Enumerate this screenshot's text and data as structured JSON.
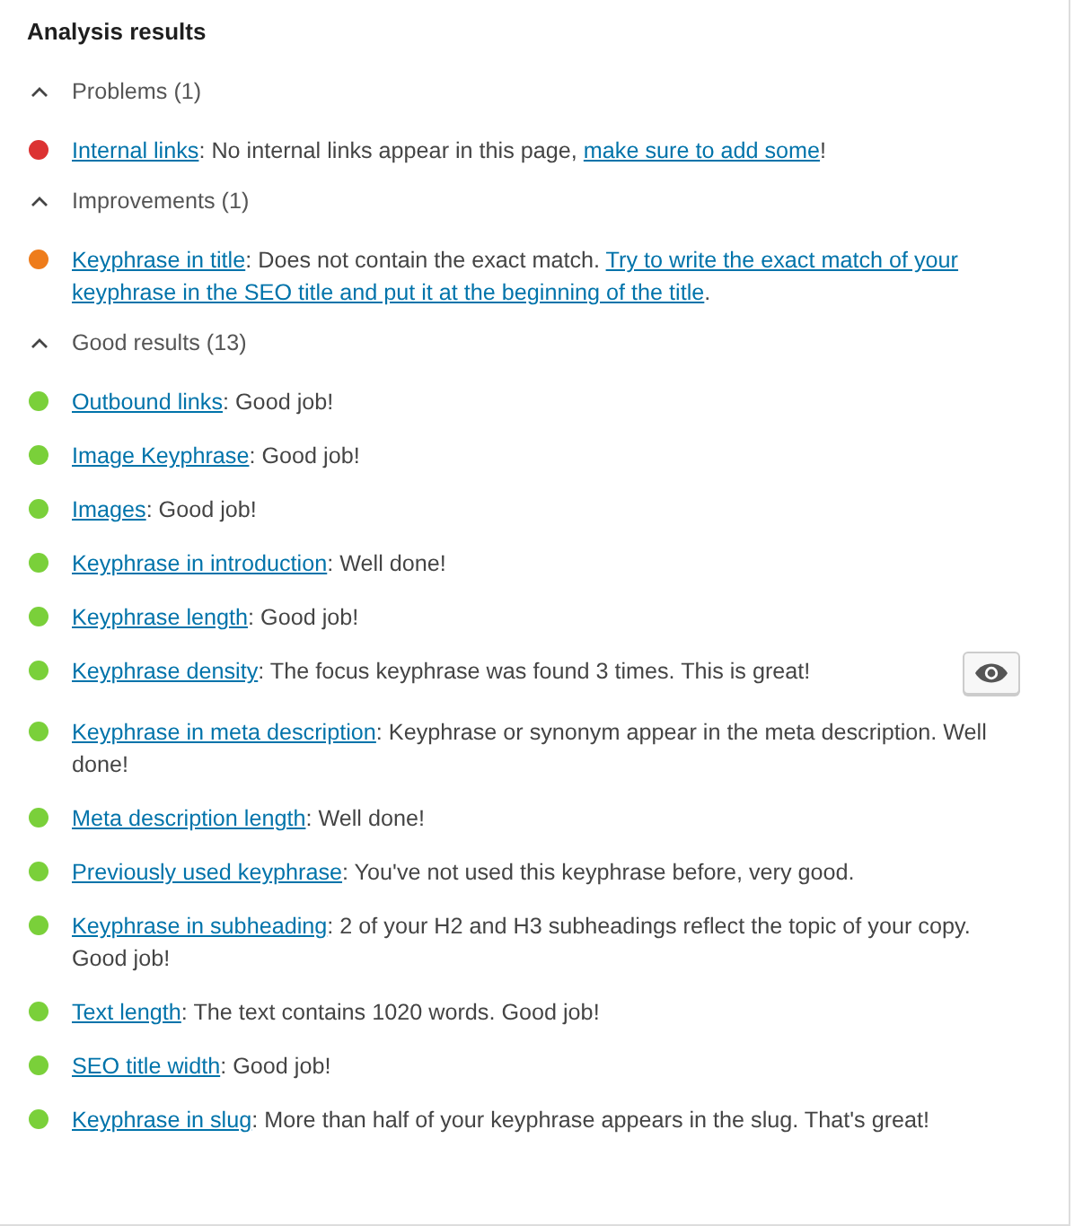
{
  "title": "Analysis results",
  "sections": [
    {
      "label": "Problems (1)",
      "expanded": true,
      "items": [
        {
          "kind": "result",
          "color": "#dc3232",
          "link": "Internal links",
          "text": ": No internal links appear in this page, ",
          "link2": [
            "make sure to add some"
          ],
          "tail": "!"
        }
      ]
    },
    {
      "label": "Improvements (1)",
      "expanded": true,
      "items": [
        {
          "kind": "result",
          "color": "#ee7c1b",
          "link": "Keyphrase in title",
          "text": ": Does not contain the exact match. ",
          "link2": [
            "Try to write the exact match of your",
            "keyphrase in the SEO title and put it at the beginning of the title"
          ],
          "tail": "."
        }
      ]
    },
    {
      "label": "Good results (13)",
      "expanded": true,
      "items": [
        {
          "kind": "result",
          "color": "#7ad03a",
          "link": "Outbound links",
          "text": ": Good job!"
        },
        {
          "kind": "result",
          "color": "#7ad03a",
          "link": "Image Keyphrase",
          "text": ": Good job!"
        },
        {
          "kind": "result",
          "color": "#7ad03a",
          "link": "Images",
          "text": ": Good job!"
        },
        {
          "kind": "result",
          "color": "#7ad03a",
          "link": "Keyphrase in introduction",
          "text": ": Well done!"
        },
        {
          "kind": "result",
          "color": "#7ad03a",
          "link": "Keyphrase length",
          "text": ": Good job!"
        },
        {
          "kind": "result-with-toggle",
          "color": "#7ad03a",
          "link": "Keyphrase density",
          "text": ": The focus keyphrase was found 3 times. This is great!"
        },
        {
          "kind": "result",
          "color": "#7ad03a",
          "link": "Keyphrase in meta description",
          "text": ": Keyphrase or synonym appear in the meta description. Well done!"
        },
        {
          "kind": "result",
          "color": "#7ad03a",
          "link": "Meta description length",
          "text": ": Well done!"
        },
        {
          "kind": "result",
          "color": "#7ad03a",
          "link": "Previously used keyphrase",
          "text": ": You've not used this keyphrase before, very good."
        },
        {
          "kind": "result",
          "color": "#7ad03a",
          "link": "Keyphrase in subheading",
          "text": ": 2 of your H2 and H3 subheadings reflect the topic of your copy. Good job!"
        },
        {
          "kind": "result",
          "color": "#7ad03a",
          "link": "Text length",
          "text": ": The text contains 1020 words. Good job!"
        },
        {
          "kind": "result",
          "color": "#7ad03a",
          "link": "SEO title width",
          "text": ": Good job!"
        },
        {
          "kind": "result",
          "color": "#7ad03a",
          "link": "Keyphrase in slug",
          "text": ": More than half of your keyphrase appears in the slug. That's great!"
        }
      ]
    }
  ]
}
